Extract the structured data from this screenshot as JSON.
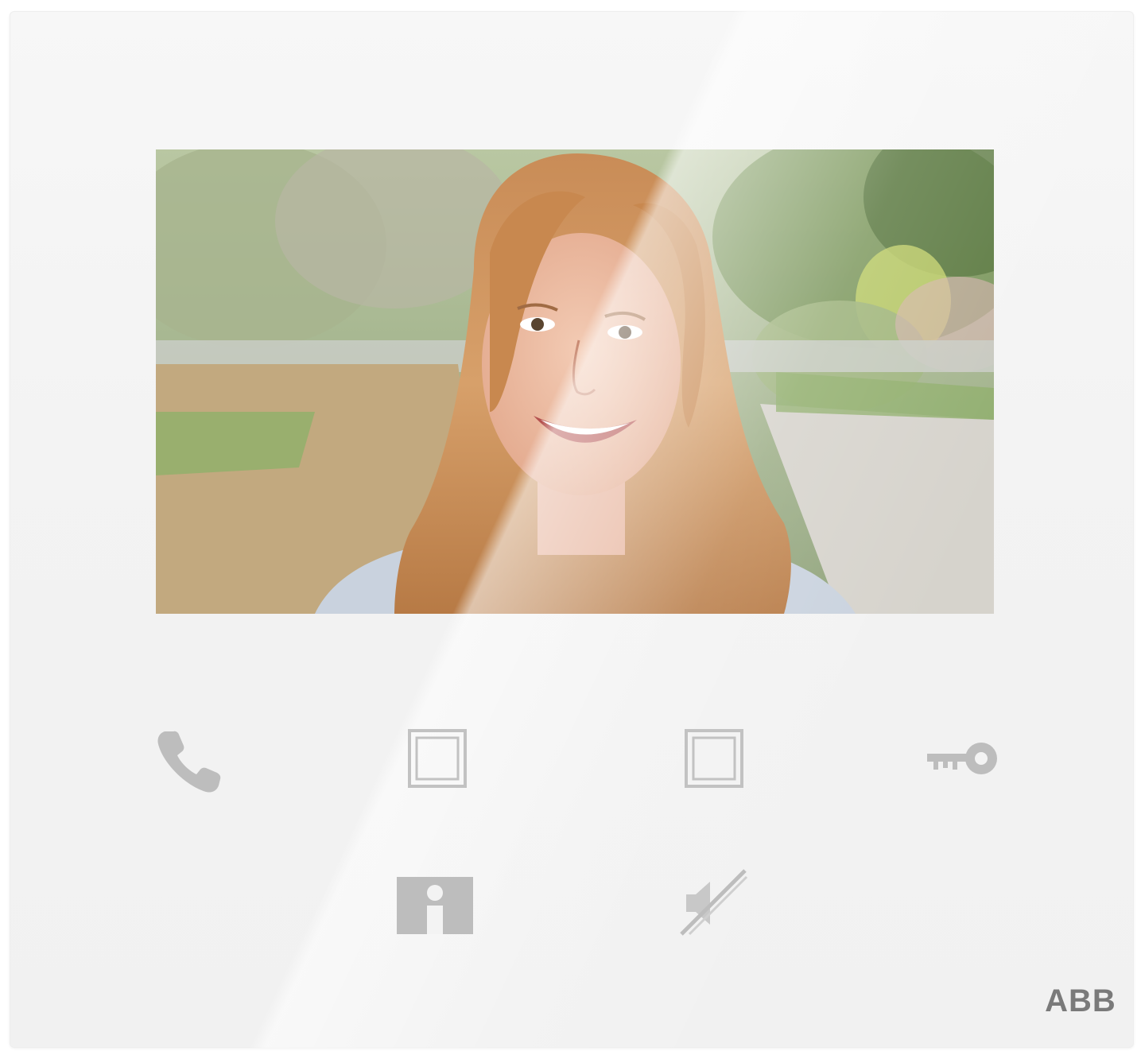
{
  "device": {
    "brand_logo": "ABB",
    "brand_color": "#7a7a7a",
    "icon_color": "#bdbdbd",
    "screen": {
      "content": "video-feed",
      "icon": "video-feed-icon"
    },
    "buttons": [
      {
        "id": "call",
        "icon": "phone-icon"
      },
      {
        "id": "function-1",
        "icon": "square-icon"
      },
      {
        "id": "function-2",
        "icon": "square-icon"
      },
      {
        "id": "door-open",
        "icon": "key-icon"
      },
      {
        "id": "info",
        "icon": "info-icon"
      },
      {
        "id": "mute",
        "icon": "mute-icon"
      }
    ]
  }
}
